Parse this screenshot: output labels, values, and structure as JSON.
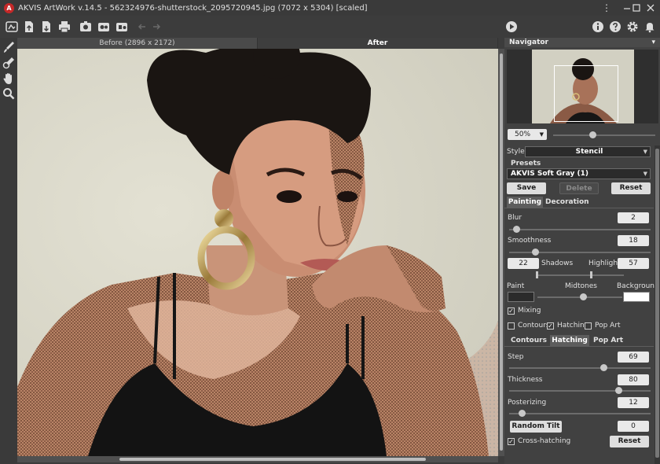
{
  "window": {
    "app_icon_text": "A",
    "title": "AKVIS ArtWork v.14.5 - 562324976-shutterstock_2095720945.jpg (7072 x 5304) [scaled]"
  },
  "canvas_tabs": {
    "before": "Before (2896 x 2172)",
    "after": "After"
  },
  "navigator": {
    "title": "Navigator",
    "zoom": "50%"
  },
  "settings": {
    "style_label": "Style:",
    "style_value": "Stencil",
    "presets_label": "Presets",
    "preset_value": "AKVIS Soft Gray (1)",
    "save_label": "Save",
    "delete_label": "Delete",
    "reset_label": "Reset",
    "tabs": [
      "Painting",
      "Decoration"
    ],
    "blur_label": "Blur",
    "blur_value": "2",
    "smoothness_label": "Smoothness",
    "smoothness_value": "18",
    "shadows_value": "22",
    "shadows_label": "Shadows",
    "highlights_label": "Highlights",
    "highlights_value": "57",
    "paint_label": "Paint",
    "midtones_label": "Midtones",
    "background_label": "Background",
    "paint_color": "#2b2b2b",
    "background_color": "#ffffff",
    "mixing_label": "Mixing",
    "contours_check_label": "Contours",
    "hatching_check_label": "Hatching",
    "popart_check_label": "Pop Art",
    "subtabs": [
      "Contours",
      "Hatching",
      "Pop Art"
    ],
    "step_label": "Step",
    "step_value": "69",
    "thickness_label": "Thickness",
    "thickness_value": "80",
    "posterizing_label": "Posterizing",
    "posterizing_value": "12",
    "random_tilt_label": "Random Tilt",
    "random_tilt_value": "0",
    "crosshatching_label": "Cross-hatching",
    "reset2_label": "Reset",
    "check_mark": "✓"
  },
  "icons": {
    "window_controls": [
      "more-options-icon",
      "minimize-icon",
      "maximize-icon",
      "close-icon"
    ],
    "toolbar": [
      "workspace-icon",
      "open-icon",
      "save-icon",
      "print-icon",
      "batch-icon",
      "plugin-icon",
      "plugin-alt-icon",
      "undo-icon",
      "redo-icon",
      "run-icon",
      "info-icon",
      "help-icon",
      "settings-icon",
      "notifications-icon"
    ],
    "left_tools": [
      "brush-icon",
      "eraser-brush-icon",
      "hand-icon",
      "zoom-icon"
    ]
  }
}
